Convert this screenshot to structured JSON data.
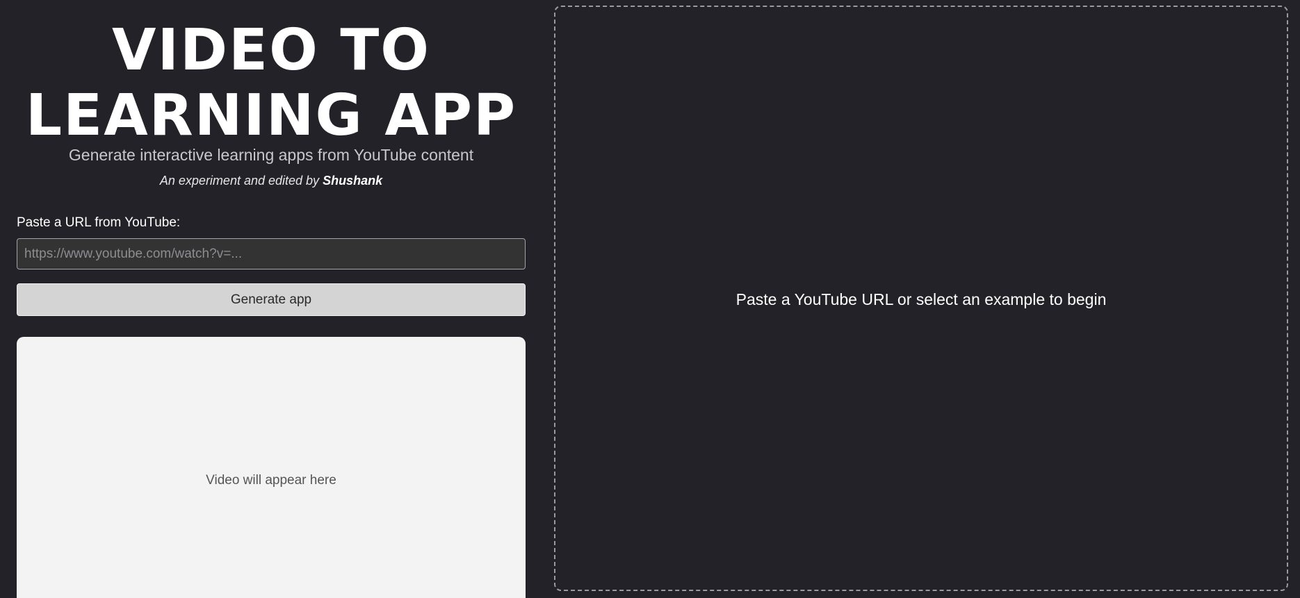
{
  "header": {
    "title_line1": "VIDEO TO",
    "title_line2": "LEARNING APP",
    "subtitle": "Generate interactive learning apps from YouTube content",
    "credit_prefix": "An experiment and edited by",
    "credit_name": "Shushank"
  },
  "form": {
    "url_label": "Paste a URL from YouTube:",
    "url_value": "",
    "url_placeholder": "https://www.youtube.com/watch?v=...",
    "generate_label": "Generate app"
  },
  "video": {
    "placeholder": "Video will appear here"
  },
  "output": {
    "placeholder": "Paste a YouTube URL or select an example to begin"
  },
  "colors": {
    "background": "#232228",
    "input_background": "#333333",
    "button_background": "#d4d4d4",
    "video_background": "#f3f3f3",
    "dashed_border": "#9a9a9f"
  }
}
